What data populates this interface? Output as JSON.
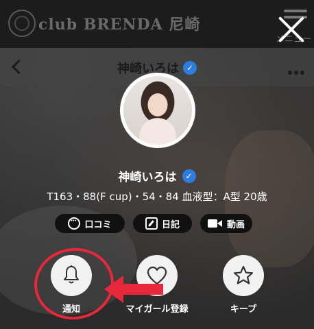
{
  "brand": {
    "name": "club BRENDA 尼崎",
    "menu_label": "メニュー"
  },
  "header": {
    "title": "神崎いろは"
  },
  "profile": {
    "name": "神崎いろは",
    "stats": "T163・88(F cup)・54・84  血液型：A型  20歳"
  },
  "pills": [
    {
      "label": "口コミ",
      "icon": "speech-bubble-icon"
    },
    {
      "label": "日記",
      "icon": "edit-icon"
    },
    {
      "label": "動画",
      "icon": "video-camera-icon"
    }
  ],
  "actions": [
    {
      "label": "通知",
      "icon": "bell-icon"
    },
    {
      "label": "マイガール登録",
      "icon": "heart-icon"
    },
    {
      "label": "キープ",
      "icon": "star-icon"
    }
  ],
  "colors": {
    "accent_verified": "#2d7de0",
    "annotation_red": "#e8283a"
  }
}
